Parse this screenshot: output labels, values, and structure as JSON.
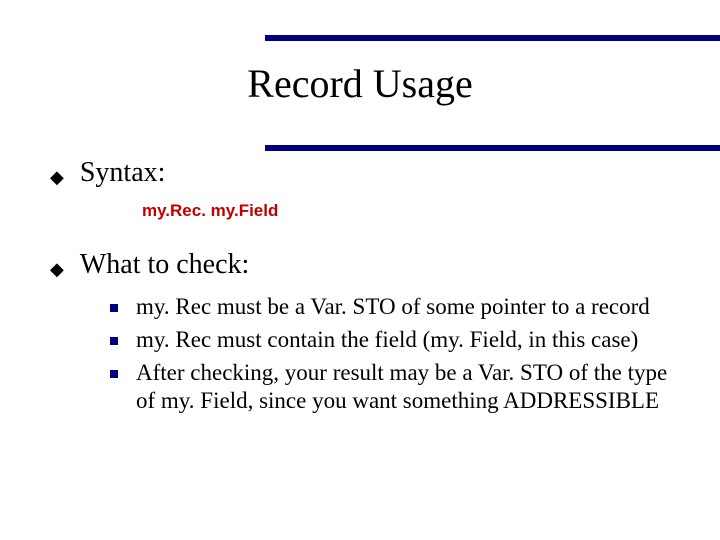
{
  "slide": {
    "title": "Record Usage",
    "bullets": [
      {
        "label": "Syntax:"
      },
      {
        "label": "What to check:"
      }
    ],
    "syntax_code": "my.Rec. my.Field",
    "subitems": [
      {
        "text": "my. Rec must be a Var. STO of some pointer to a record"
      },
      {
        "text": "my. Rec must contain the field (my. Field, in this case)"
      },
      {
        "text": "After checking, your result may be a Var. STO of the type of my. Field, since you want something ADDRESSIBLE"
      }
    ]
  }
}
